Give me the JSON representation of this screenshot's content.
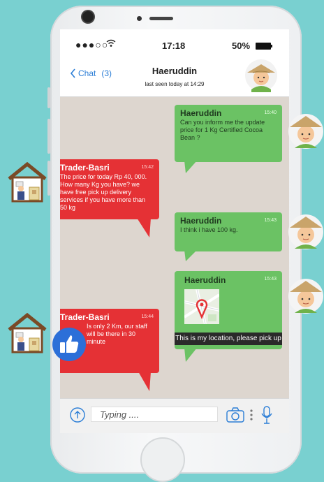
{
  "status": {
    "signal": "●●●○○",
    "time": "17:18",
    "battery": "50%"
  },
  "header": {
    "back_label": "Chat",
    "back_count": "(3)",
    "contact": "Haeruddin",
    "last_seen": "last seen today at 14:29"
  },
  "messages": [
    {
      "sender": "Haeruddin",
      "time": "15:40",
      "text": "Can you inform me the update price for 1 Kg Certified Cocoa Bean ?"
    },
    {
      "sender": "Trader-Basri",
      "time": "15:42",
      "text": "The price for today Rp 40, 000. How many Kg you have? we have free pick up delivery services if you have more than 50 kg"
    },
    {
      "sender": "Haeruddin",
      "time": "15:43",
      "text": "I think i have 100 kg."
    },
    {
      "sender": "Haeruddin",
      "time": "15:43",
      "caption": "This is my location, please pick up"
    },
    {
      "sender": "Trader-Basri",
      "time": "15:44",
      "text": "Is only 2 Km, our staff will be there in 30 minute"
    }
  ],
  "composer": {
    "placeholder": "Typing ...."
  },
  "colors": {
    "background": "#79d0d0",
    "green_bubble": "#6bc264",
    "red_bubble": "#e53135",
    "link": "#2a7dd6"
  },
  "icons": [
    "signal-icon",
    "wifi-icon",
    "battery-icon",
    "back-chevron-icon",
    "map-pin-icon",
    "thumbs-up-icon",
    "upload-icon",
    "camera-icon",
    "more-icon",
    "microphone-icon"
  ]
}
